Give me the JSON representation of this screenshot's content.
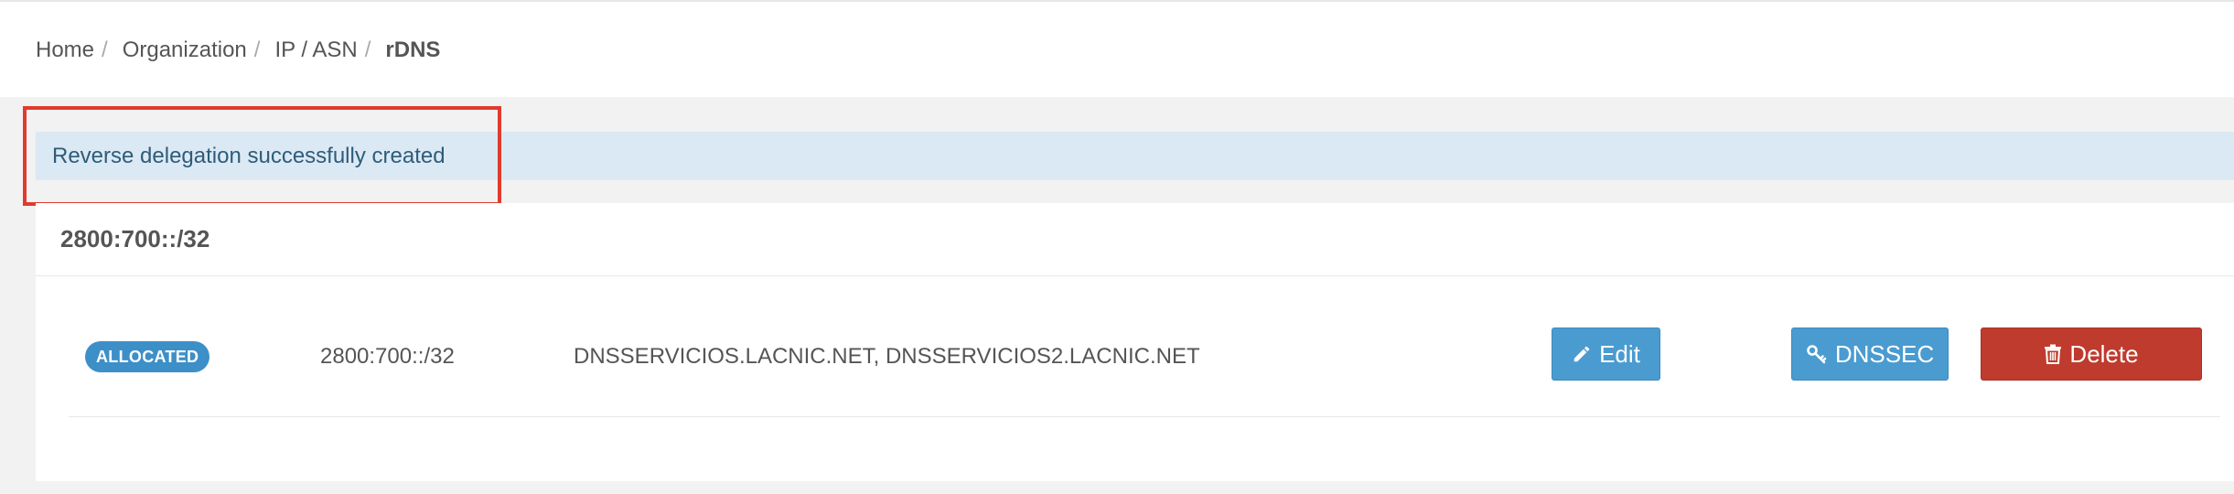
{
  "breadcrumb": {
    "items": [
      "Home",
      "Organization",
      "IP / ASN"
    ],
    "separator": "/",
    "current": "rDNS"
  },
  "alert": {
    "message": "Reverse delegation successfully created",
    "highlight_color": "#e03c2c"
  },
  "panel": {
    "title": "2800:700::/32",
    "rows": [
      {
        "status": "ALLOCATED",
        "prefix": "2800:700::/32",
        "nameservers": "DNSSERVICIOS.LACNIC.NET, DNSSERVICIOS2.LACNIC.NET"
      }
    ]
  },
  "buttons": {
    "edit_label": "Edit",
    "dnssec_label": "DNSSEC",
    "delete_label": "Delete"
  },
  "colors": {
    "badge": "#3d8fc8",
    "primary_button": "#4a9bd0",
    "danger_button": "#bf3b2e",
    "alert_bg": "#dbe9f4"
  },
  "icons": {
    "edit": "pencil-icon",
    "dnssec": "key-icon",
    "delete": "trash-icon"
  }
}
